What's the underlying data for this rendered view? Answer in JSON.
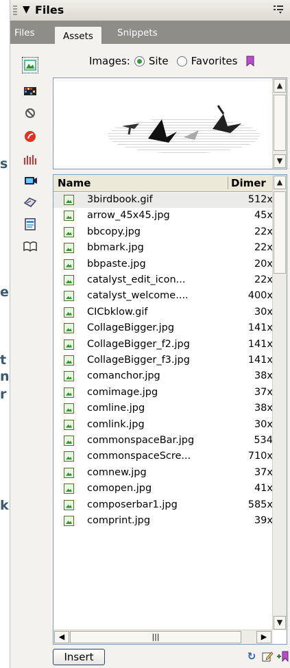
{
  "background_fragments": [
    "s",
    "e",
    "t",
    "n",
    "r",
    "k"
  ],
  "panel": {
    "title": "Files",
    "tabs": [
      "Files",
      "Assets",
      "Snippets"
    ],
    "active_tab": "Assets"
  },
  "images_row": {
    "label": "Images:",
    "site_label": "Site",
    "favorites_label": "Favorites"
  },
  "list": {
    "headers": {
      "name": "Name",
      "dimensions": "Dimer"
    },
    "rows": [
      {
        "name": "3birdbook.gif",
        "dim": "512x"
      },
      {
        "name": "arrow_45x45.jpg",
        "dim": "45x"
      },
      {
        "name": "bbcopy.jpg",
        "dim": "22x"
      },
      {
        "name": "bbmark.jpg",
        "dim": "22x"
      },
      {
        "name": "bbpaste.jpg",
        "dim": "20x"
      },
      {
        "name": "catalyst_edit_icon...",
        "dim": "22x"
      },
      {
        "name": "catalyst_welcome....",
        "dim": "400x"
      },
      {
        "name": "CICbklow.gif",
        "dim": "30x"
      },
      {
        "name": "CollageBigger.jpg",
        "dim": "141x"
      },
      {
        "name": "CollageBigger_f2.jpg",
        "dim": "141x"
      },
      {
        "name": "CollageBigger_f3.jpg",
        "dim": "141x"
      },
      {
        "name": "comanchor.jpg",
        "dim": "38x"
      },
      {
        "name": "comimage.jpg",
        "dim": "37x"
      },
      {
        "name": "comline.jpg",
        "dim": "38x"
      },
      {
        "name": "comlink.jpg",
        "dim": "30x"
      },
      {
        "name": "commonspaceBar.jpg",
        "dim": "534"
      },
      {
        "name": "commonspaceScre...",
        "dim": "710x"
      },
      {
        "name": "comnew.jpg",
        "dim": "37x"
      },
      {
        "name": "comopen.jpg",
        "dim": "41x"
      },
      {
        "name": "composerbar1.jpg",
        "dim": "585x"
      },
      {
        "name": "comprint.jpg",
        "dim": "39x"
      }
    ]
  },
  "bottom": {
    "insert_label": "Insert"
  },
  "colors": {
    "tab_strip": "#8e8d88",
    "panel_bg": "#f3f2ee",
    "list_border": "#7f9db9"
  }
}
